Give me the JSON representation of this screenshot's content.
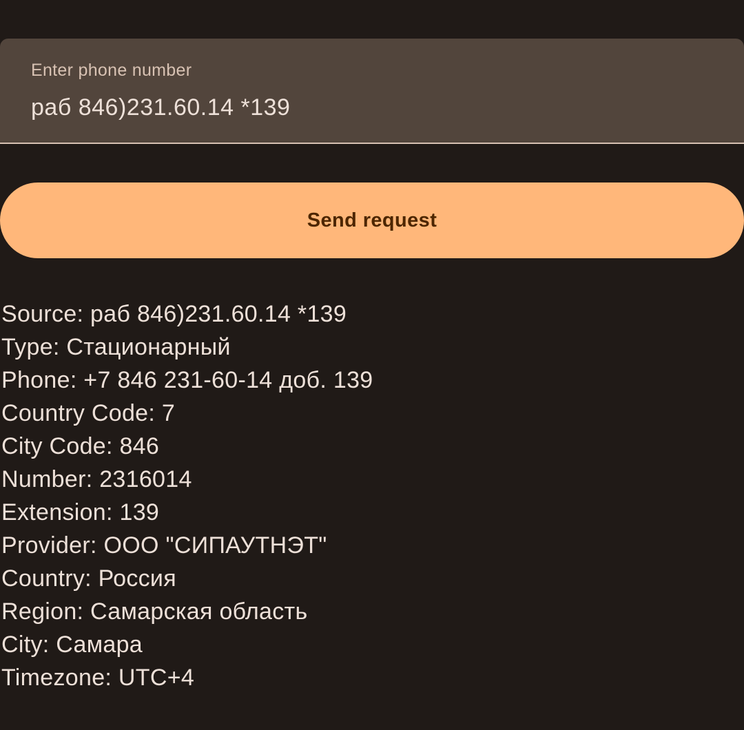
{
  "input": {
    "label": "Enter phone number",
    "value": "раб 846)231.60.14 *139"
  },
  "send_button": {
    "label": "Send request"
  },
  "colors": {
    "background": "#201a17",
    "field_background": "#52453c",
    "button_background": "#ffb77a",
    "button_text": "#4d2600",
    "text": "#ede0d8"
  },
  "results": [
    "Source: раб 846)231.60.14 *139",
    "Type: Стационарный",
    "Phone: +7 846 231-60-14 доб. 139",
    "Country Code: 7",
    "City Code: 846",
    "Number: 2316014",
    "Extension: 139",
    "Provider: ООО \"СИПАУТНЭТ\"",
    "Country: Россия",
    "Region: Самарская область",
    "City: Самара",
    "Timezone: UTC+4"
  ]
}
